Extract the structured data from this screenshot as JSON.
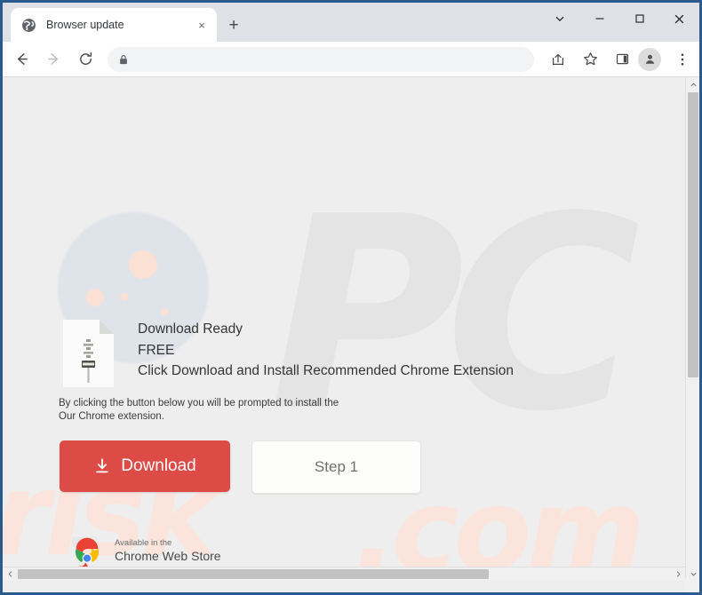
{
  "window": {
    "border_color": "#2a5b8c",
    "controls": {
      "tab_search_icon": "chevron-down-icon",
      "minimize_icon": "minimize-icon",
      "maximize_icon": "maximize-icon",
      "close_icon": "close-icon"
    }
  },
  "tabstrip": {
    "tabs": [
      {
        "favicon": "globe-icon",
        "title": "Browser update",
        "close_label": "×"
      }
    ],
    "new_tab_label": "+"
  },
  "toolbar": {
    "back_icon": "arrow-left-icon",
    "forward_icon": "arrow-right-icon",
    "reload_icon": "reload-icon",
    "omnibox": {
      "lock_icon": "lock-icon",
      "value": "",
      "placeholder": ""
    },
    "actions": [
      {
        "name": "share-icon"
      },
      {
        "name": "bookmark-star-icon"
      },
      {
        "name": "side-panel-icon"
      },
      {
        "name": "profile-avatar-icon"
      },
      {
        "name": "more-menu-icon"
      }
    ]
  },
  "page": {
    "background_color": "#eeeeee",
    "watermark": {
      "logo_text": "PC",
      "logo_color": "#e4e4e4",
      "domain_left": "risk",
      "domain_right": ".com",
      "domain_color": "#fae4dc"
    },
    "file_icon": "zip-file-icon",
    "headings": [
      "Download Ready",
      "FREE",
      "Click Download and Install Recommended Chrome Extension"
    ],
    "subtext_lines": [
      "By clicking the button below you will be prompted to install the",
      "Our Chrome extension."
    ],
    "download_button": {
      "label": "Download",
      "icon": "download-arrow-icon",
      "color": "#dd4b47",
      "text_color": "#ffffff"
    },
    "step_button": {
      "label": "Step 1",
      "color": "#fdfdfc",
      "text_color": "#6f6f6f"
    },
    "web_store_badge": {
      "logo": "chrome-logo-icon",
      "small_text": "Available in the",
      "large_text": "Chrome Web Store"
    }
  },
  "scrollbars": {
    "vertical": {
      "up_arrow": "▲",
      "down_arrow": "▼"
    },
    "horizontal": {
      "left_arrow": "◀",
      "right_arrow": "▶"
    }
  }
}
